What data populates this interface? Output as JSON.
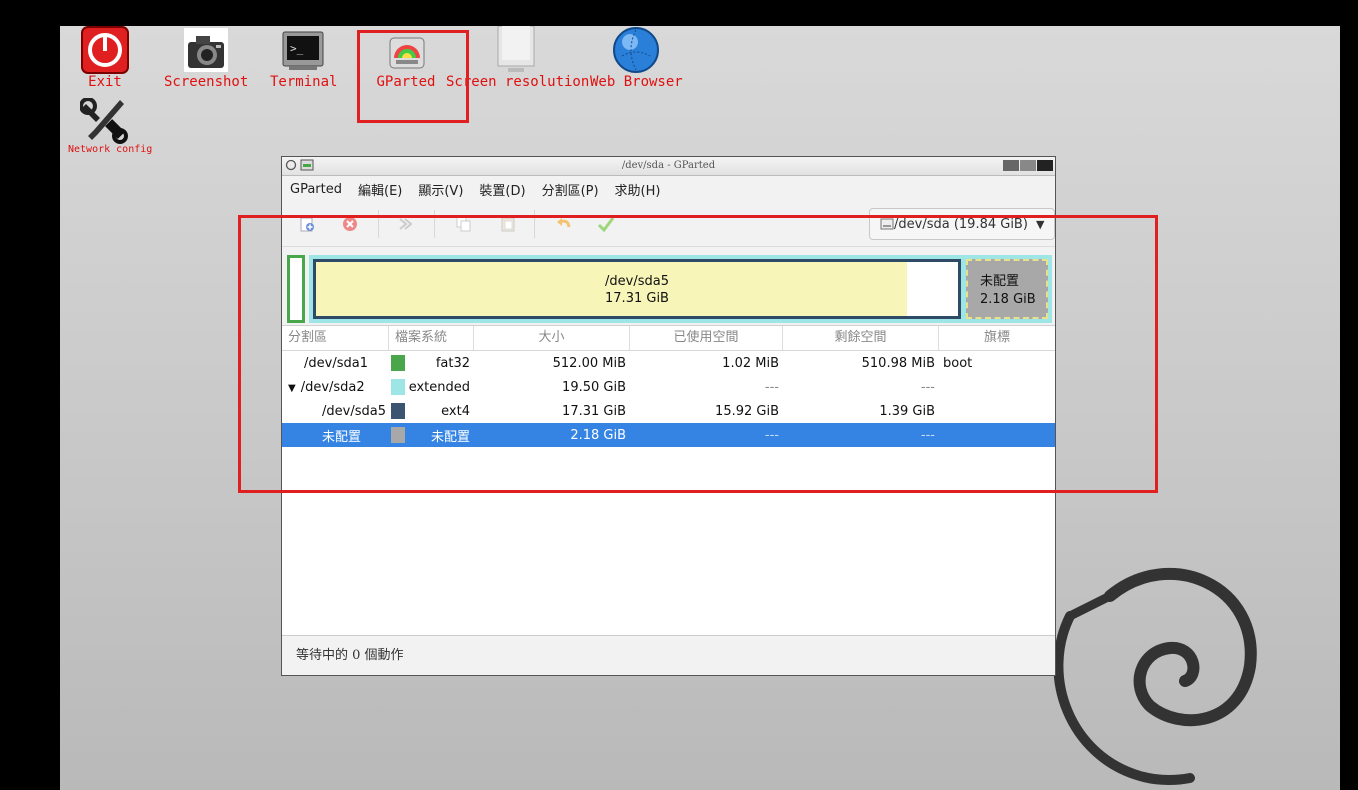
{
  "desktop": {
    "icons": [
      {
        "label": "Exit",
        "icon": "power-icon"
      },
      {
        "label": "Screenshot",
        "icon": "camera-icon"
      },
      {
        "label": "Terminal",
        "icon": "terminal-icon"
      },
      {
        "label": "GParted",
        "icon": "gparted-icon"
      },
      {
        "label": "Screen resolution",
        "icon": "monitor-icon"
      },
      {
        "label": "Web Browser",
        "icon": "globe-icon"
      },
      {
        "label": "Network config",
        "icon": "tools-icon"
      }
    ]
  },
  "window": {
    "title": "/dev/sda - GParted",
    "menu": [
      "GParted",
      "編輯(E)",
      "顯示(V)",
      "裝置(D)",
      "分割區(P)",
      "求助(H)"
    ],
    "device_selector": "/dev/sda (19.84 GiB)",
    "diskmap": {
      "main_name": "/dev/sda5",
      "main_size": "17.31 GiB",
      "main_used_fraction": 0.92,
      "unalloc_name": "未配置",
      "unalloc_size": "2.18 GiB"
    },
    "columns": [
      "分割區",
      "檔案系統",
      "大小",
      "已使用空間",
      "剩餘空間",
      "旗標"
    ],
    "rows": [
      {
        "partition": "/dev/sda1",
        "color": "#4aa64a",
        "fs": "fat32",
        "size": "512.00 MiB",
        "used": "1.02 MiB",
        "free": "510.98 MiB",
        "flags": "boot"
      },
      {
        "partition": "/dev/sda2",
        "color": "#9ee6e6",
        "fs": "extended",
        "size": "19.50 GiB",
        "used": "---",
        "free": "---",
        "flags": ""
      },
      {
        "partition": "/dev/sda5",
        "color": "#3b5470",
        "fs": "ext4",
        "size": "17.31 GiB",
        "used": "15.92 GiB",
        "free": "1.39 GiB",
        "flags": ""
      },
      {
        "partition": "未配置",
        "color": "#a8a8a8",
        "fs": "未配置",
        "size": "2.18 GiB",
        "used": "---",
        "free": "---",
        "flags": ""
      }
    ],
    "status": "等待中的 0 個動作"
  },
  "colors": {
    "accent": "#3584e4",
    "annotation": "#e02020"
  }
}
